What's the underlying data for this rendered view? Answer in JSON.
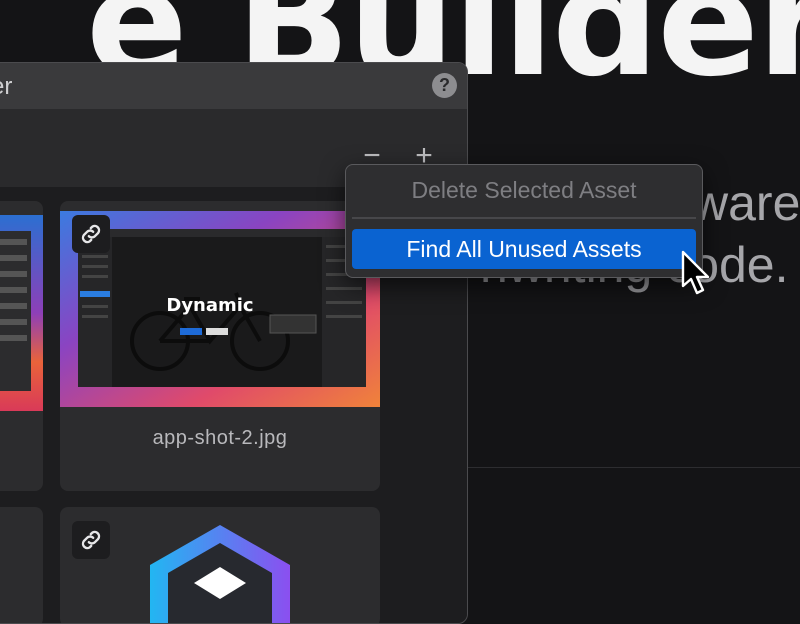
{
  "background": {
    "heading": "Builder",
    "heading_partial_left": "e",
    "body_line1": "ware.",
    "body_line2": "ode.",
    "body_line2_prefix": "nwriting c"
  },
  "panel": {
    "title": "er",
    "help_label": "?",
    "toolbar": {
      "remove_label": "−",
      "add_label": "+"
    }
  },
  "assets": [
    {
      "name": "app-shot-2.jpg",
      "thumb_headline": "Dynamic",
      "linked": true,
      "icon": "link-icon"
    },
    {
      "name": "",
      "linked": true,
      "icon": "link-icon"
    }
  ],
  "context_menu": {
    "items": [
      {
        "label": "Delete Selected Asset",
        "enabled": false
      },
      {
        "label": "Find All Unused Assets",
        "enabled": true,
        "highlighted": true
      }
    ],
    "highlight_color": "#0a63d1"
  },
  "cursor": "arrow-cursor-icon"
}
